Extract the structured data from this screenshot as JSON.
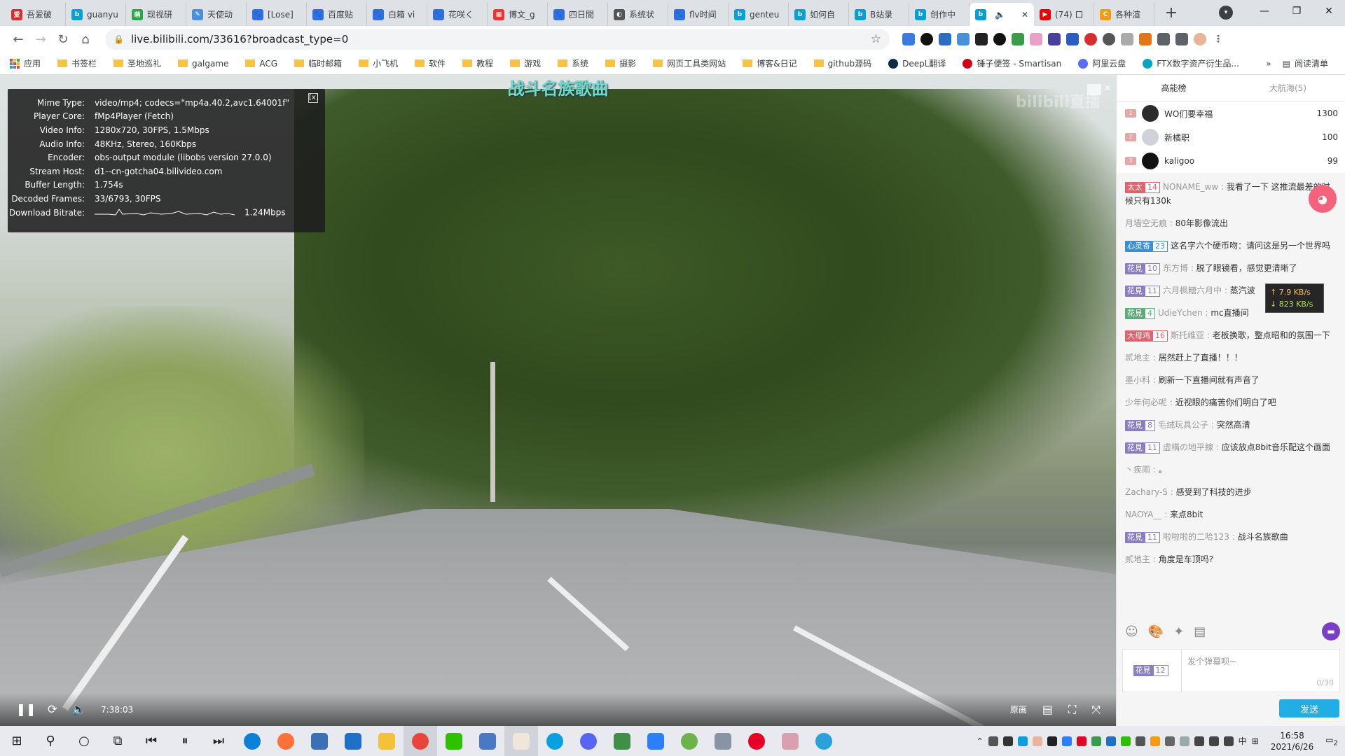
{
  "tabs": [
    {
      "title": "吾爱破",
      "color": "#d93025",
      "glyph": "爱"
    },
    {
      "title": "guanyu",
      "color": "#00a1d6",
      "glyph": "b"
    },
    {
      "title": "现视研",
      "color": "#2aa745",
      "glyph": "萌"
    },
    {
      "title": "天使动",
      "color": "#4a90d9",
      "glyph": "✎"
    },
    {
      "title": "[Lose]",
      "color": "#2f6fe0",
      "glyph": "🐾"
    },
    {
      "title": "百度贴",
      "color": "#2f6fe0",
      "glyph": "🐾"
    },
    {
      "title": "白箱 vi",
      "color": "#2f6fe0",
      "glyph": "🐾"
    },
    {
      "title": "花咲く",
      "color": "#2f6fe0",
      "glyph": "🐾"
    },
    {
      "title": "博文_g",
      "color": "#e33",
      "glyph": "▦"
    },
    {
      "title": "四日間",
      "color": "#2f6fe0",
      "glyph": "🐾"
    },
    {
      "title": "系统状",
      "color": "#555",
      "glyph": "◐"
    },
    {
      "title": "flv时间",
      "color": "#2f6fe0",
      "glyph": "🐾"
    },
    {
      "title": "genteu",
      "color": "#00a1d6",
      "glyph": "b"
    },
    {
      "title": "如何自",
      "color": "#00a1d6",
      "glyph": "b"
    },
    {
      "title": "B站录",
      "color": "#00a1d6",
      "glyph": "b"
    },
    {
      "title": "创作中",
      "color": "#00a1d6",
      "glyph": "b"
    },
    {
      "title": "",
      "color": "#00a1d6",
      "glyph": "b",
      "active": true
    },
    {
      "title": "(74) 口",
      "color": "#e00",
      "glyph": "▶"
    },
    {
      "title": "各种渲",
      "color": "#f39c12",
      "glyph": "C"
    }
  ],
  "tab_close": "✕",
  "new_tab": "+",
  "window_controls": {
    "minimize": "—",
    "restore": "❐",
    "close": "✕"
  },
  "url": "live.bilibili.com/33616?broadcast_type=0",
  "bookmarks": [
    {
      "label": "应用",
      "type": "apps"
    },
    {
      "label": "书签栏",
      "type": "folder"
    },
    {
      "label": "圣地巡礼",
      "type": "folder"
    },
    {
      "label": "galgame",
      "type": "folder"
    },
    {
      "label": "ACG",
      "type": "folder"
    },
    {
      "label": "临时邮箱",
      "type": "folder"
    },
    {
      "label": "小飞机",
      "type": "folder"
    },
    {
      "label": "软件",
      "type": "folder"
    },
    {
      "label": "教程",
      "type": "folder"
    },
    {
      "label": "游戏",
      "type": "folder"
    },
    {
      "label": "系统",
      "type": "folder"
    },
    {
      "label": "摄影",
      "type": "folder"
    },
    {
      "label": "网页工具类网站",
      "type": "folder"
    },
    {
      "label": "博客&日记",
      "type": "folder"
    },
    {
      "label": "github源码",
      "type": "folder"
    },
    {
      "label": "DeepL翻译",
      "type": "site",
      "color": "#0f2b46"
    },
    {
      "label": "锤子便签 - Smartisan",
      "type": "site",
      "color": "#d0021b"
    },
    {
      "label": "阿里云盘",
      "type": "site",
      "color": "#5b6cf9"
    },
    {
      "label": "FTX数字资产衍生品...",
      "type": "site",
      "color": "#02a6c2"
    }
  ],
  "bookmarks_more": "»",
  "reading_list": "阅读清单",
  "video": {
    "title": "战斗名族歌曲",
    "watermark": "bilibili直播"
  },
  "stats": {
    "close": "[x]",
    "rows": [
      {
        "label": "Mime Type:",
        "value": "video/mp4; codecs=\"mp4a.40.2,avc1.64001f\""
      },
      {
        "label": "Player Core:",
        "value": "fMp4Player (Fetch)"
      },
      {
        "label": "Video Info:",
        "value": "1280x720, 30FPS, 1.5Mbps"
      },
      {
        "label": "Audio Info:",
        "value": "48KHz, Stereo, 160Kbps"
      },
      {
        "label": "Encoder:",
        "value": "obs-output module (libobs version 27.0.0)"
      },
      {
        "label": "Stream Host:",
        "value": "d1--cn-gotcha04.bilivideo.com"
      },
      {
        "label": "Buffer Length:",
        "value": "1.754s"
      },
      {
        "label": "Decoded Frames:",
        "value": "33/6793, 30FPS"
      }
    ],
    "bitrate_label": "Download Bitrate:",
    "bitrate_value": "1.24Mbps"
  },
  "controls": {
    "time": "7:38:03",
    "quality": "原画"
  },
  "netspeed": {
    "up": "↑ 7.9 KB/s",
    "down": "↓ 823 KB/s"
  },
  "panel": {
    "tabs": [
      "高能榜",
      "大航海(5)"
    ],
    "ranks": [
      {
        "rank": "1",
        "name": "WO们要幸福",
        "score": "1300"
      },
      {
        "rank": "2",
        "name": "新橘职",
        "score": "100"
      },
      {
        "rank": "3",
        "name": "kaligoo",
        "score": "99"
      }
    ],
    "messages": [
      {
        "badge": "太太",
        "badge_color": "#e0626c",
        "level": "14",
        "user": "NONAME_ww",
        "text": "我看了一下 这推流最差的时候只有130k"
      },
      {
        "user": "月墙空无痕",
        "text": "80年影像流出"
      },
      {
        "badge": "心灵寄",
        "badge_color": "#3a8fd8",
        "level": "23",
        "user": "",
        "text": "这名字六个硬币吻：请问这是另一个世界吗"
      },
      {
        "badge": "花見",
        "badge_color": "#8a7ec0",
        "level": "10",
        "user": "东方博",
        "text": "脱了眼镜看，感觉更清晰了"
      },
      {
        "badge": "花見",
        "badge_color": "#8a7ec0",
        "level": "11",
        "user": "六月枫糖六月中",
        "text": "蒸汽波"
      },
      {
        "badge": "花見",
        "badge_color": "#5fab7c",
        "level": "4",
        "user": "UdieYchen",
        "text": "mc直播间"
      },
      {
        "badge": "大母鸡",
        "badge_color": "#e0626c",
        "level": "16",
        "user": "斯托维亚",
        "text": "老板换歌，整点昭和的氛围一下"
      },
      {
        "user": "贰地主",
        "text": "居然赶上了直播！！！"
      },
      {
        "user": "墨小科",
        "text": "刷新一下直播间就有声音了"
      },
      {
        "user": "少年何必呢",
        "text": "近视眼的痛苦你们明白了吧"
      },
      {
        "badge": "花見",
        "badge_color": "#8a7ec0",
        "level": "8",
        "user": "毛绒玩具公子",
        "text": "突然高清"
      },
      {
        "badge": "花見",
        "badge_color": "#8a7ec0",
        "level": "11",
        "user": "虚構の地平線",
        "text": "应该放点8bit音乐配这个画面"
      },
      {
        "user": "丶疾雨",
        "text": "。"
      },
      {
        "user": "Zachary-S",
        "text": "感受到了科技的进步"
      },
      {
        "user": "NAOYA__",
        "text": "来点8bit"
      },
      {
        "badge": "花見",
        "badge_color": "#8a7ec0",
        "level": "11",
        "user": "啦啦啦的二哈123",
        "text": "战斗名族歌曲"
      },
      {
        "user": "贰地主",
        "text": "角度是车顶吗?"
      }
    ],
    "medal": "花見",
    "medal_level": "12",
    "input_placeholder": "发个弹幕呗~",
    "input_count": "0/30",
    "send": "发送"
  },
  "taskbar": {
    "time": "16:58",
    "date": "2021/6/26",
    "ime": "中",
    "notification_count": "2"
  }
}
